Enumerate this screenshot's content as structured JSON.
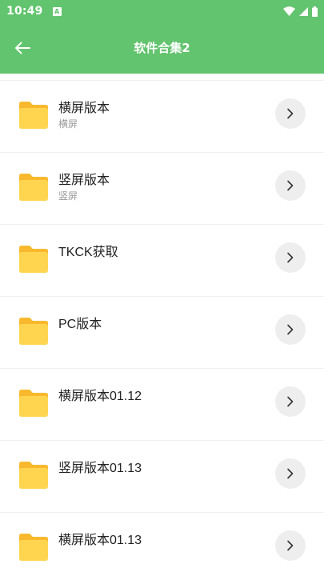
{
  "status_bar": {
    "time": "10:49",
    "notification_glyph": "A"
  },
  "app_bar": {
    "title": "软件合集2",
    "back_icon": "arrow-left-icon"
  },
  "colors": {
    "primary": "#62c46e",
    "folder": "#ffd54f",
    "folder_tab": "#f9b92d",
    "chevron_bg": "#eeeeee"
  },
  "items": [
    {
      "title": "横屏版本",
      "subtitle": "横屏"
    },
    {
      "title": "竖屏版本",
      "subtitle": "竖屏"
    },
    {
      "title": "TKCK获取",
      "subtitle": ""
    },
    {
      "title": "PC版本",
      "subtitle": ""
    },
    {
      "title": "横屏版本01.12",
      "subtitle": ""
    },
    {
      "title": "竖屏版本01.13",
      "subtitle": ""
    },
    {
      "title": "横屏版本01.13",
      "subtitle": ""
    }
  ]
}
